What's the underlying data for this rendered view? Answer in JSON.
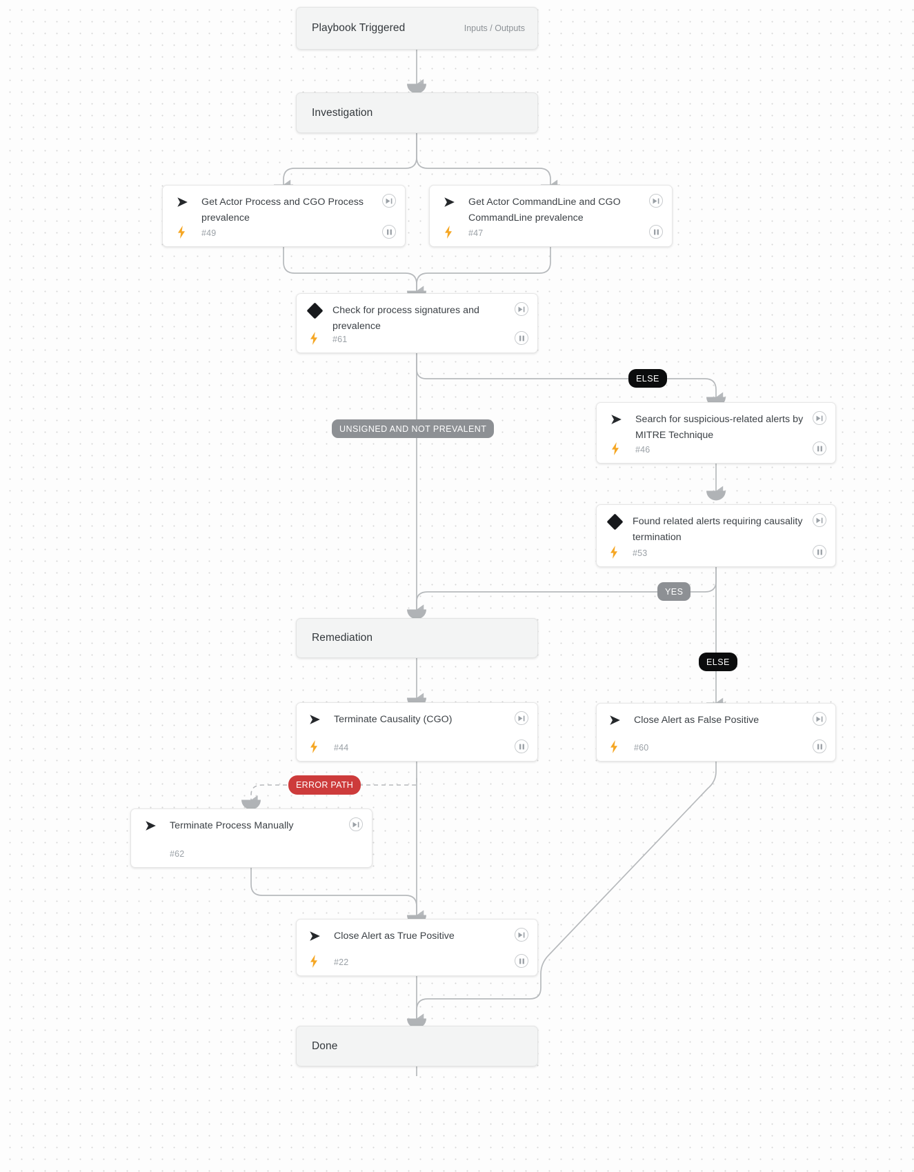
{
  "diagram": {
    "type": "playbook-workflow",
    "title": "Playbook Triggered"
  },
  "nodes": [
    {
      "id": "trigger",
      "kind": "section",
      "label": "Playbook Triggered",
      "meta": "Inputs / Outputs"
    },
    {
      "id": "investigation",
      "kind": "section",
      "label": "Investigation"
    },
    {
      "id": "t49",
      "kind": "task",
      "icon": "automation-icon",
      "label": "Get Actor Process and CGO Process prevalence",
      "task_id": "#49",
      "bolt": true,
      "play": true,
      "pause": true
    },
    {
      "id": "t47",
      "kind": "task",
      "icon": "automation-icon",
      "label": "Get Actor CommandLine and CGO CommandLine prevalence",
      "task_id": "#47",
      "bolt": true,
      "play": true,
      "pause": true
    },
    {
      "id": "t61",
      "kind": "cond",
      "icon": "condition-icon",
      "label": "Check for process signatures and prevalence",
      "task_id": "#61",
      "bolt": true,
      "play": true,
      "pause": true
    },
    {
      "id": "t46",
      "kind": "task",
      "icon": "automation-icon",
      "label": "Search for suspicious-related alerts by MITRE Technique",
      "task_id": "#46",
      "bolt": true,
      "play": true,
      "pause": true
    },
    {
      "id": "t53",
      "kind": "cond",
      "icon": "condition-icon",
      "label": "Found related alerts requiring causality termination",
      "task_id": "#53",
      "bolt": true,
      "play": true,
      "pause": true
    },
    {
      "id": "remediation",
      "kind": "section",
      "label": "Remediation"
    },
    {
      "id": "t44",
      "kind": "task",
      "icon": "automation-icon",
      "label": "Terminate Causality (CGO)",
      "task_id": "#44",
      "bolt": true,
      "play": true,
      "pause": true
    },
    {
      "id": "t60",
      "kind": "task",
      "icon": "automation-icon",
      "label": "Close Alert as False Positive",
      "task_id": "#60",
      "bolt": true,
      "play": true,
      "pause": true
    },
    {
      "id": "t62",
      "kind": "task",
      "icon": "automation-icon",
      "label": "Terminate Process Manually",
      "task_id": "#62",
      "bolt": false,
      "play": true,
      "pause": false
    },
    {
      "id": "t22",
      "kind": "task",
      "icon": "automation-icon",
      "label": "Close Alert as True Positive",
      "task_id": "#22",
      "bolt": true,
      "play": true,
      "pause": true
    },
    {
      "id": "done",
      "kind": "section",
      "label": "Done"
    }
  ],
  "edge_labels": [
    {
      "id": "else1",
      "text": "ELSE",
      "style": "dark"
    },
    {
      "id": "unsigned",
      "text": "UNSIGNED AND NOT PREVALENT",
      "style": "grey"
    },
    {
      "id": "yes",
      "text": "YES",
      "style": "grey"
    },
    {
      "id": "else2",
      "text": "ELSE",
      "style": "dark"
    },
    {
      "id": "error",
      "text": "ERROR PATH",
      "style": "error"
    }
  ],
  "colors": {
    "bolt": "#f5a623",
    "condition": "#17191c",
    "else_badge": "#0b0c0d",
    "grey_badge": "#8d9094",
    "error_badge": "#cd3b3b",
    "wire": "#b6b9bc",
    "node_bg": "#ffffff",
    "section_bg": "#f3f4f4"
  }
}
